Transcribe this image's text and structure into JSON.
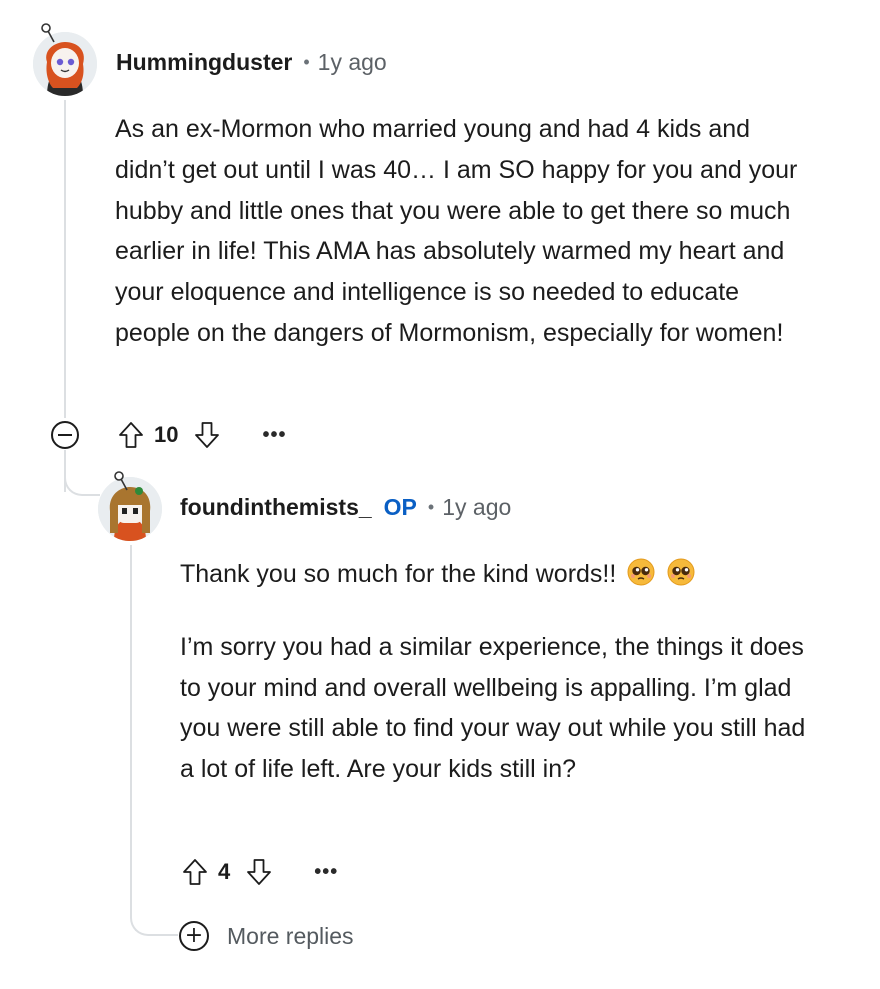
{
  "comment": {
    "username": "Hummingduster",
    "time": "1y ago",
    "body": [
      "As an ex-Mormon who married young and had 4 kids and didn’t get out until I was 40… I am SO happy for you and your hubby and little ones that you were able to get there so much earlier in life! This AMA has absolutely warmed my heart and your eloquence and intelligence is so needed to educate people on the dangers of Mormonism, especially for women!"
    ],
    "score": "10"
  },
  "reply": {
    "username": "foundinthemists_",
    "op_badge": "OP",
    "time": "1y ago",
    "line1": "Thank you so much for the kind words!!",
    "emoji": [
      "pleading-face",
      "pleading-face"
    ],
    "line2": "I’m sorry you had a similar experience, the things it does to your mind and overall wellbeing is appalling. I’m glad you were still able to find your way out while you still had a lot of life left. Are your kids still in?",
    "score": "4"
  },
  "more_replies_label": "More replies",
  "icons": {
    "upvote": "upvote-arrow-icon",
    "downvote": "downvote-arrow-icon",
    "more": "overflow-dots-icon",
    "collapse": "collapse-minus-icon",
    "expand": "expand-plus-icon"
  },
  "colors": {
    "op": "#0a5fc4",
    "thread_line": "#dcdfe2",
    "meta": "#5c6166"
  }
}
